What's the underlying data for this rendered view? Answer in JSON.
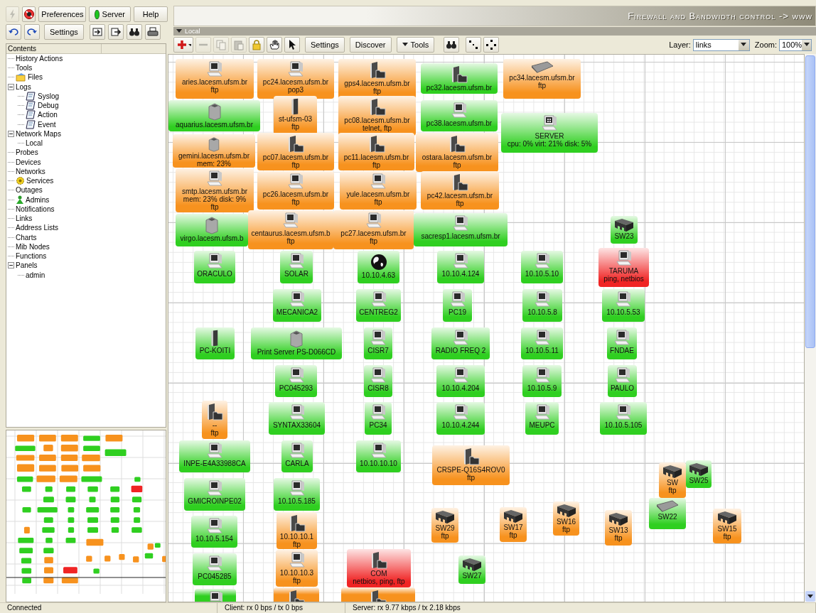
{
  "main_toolbar": {
    "icon_buttons": [
      {
        "kind": "lightning",
        "disabled": true
      },
      {
        "kind": "stop",
        "disabled": false
      }
    ],
    "buttons": [
      {
        "label": "Preferences"
      },
      {
        "label": "Server",
        "online": true
      },
      {
        "label": "Help"
      }
    ]
  },
  "edit_toolbar": {
    "icon_buttons_left": [
      {
        "kind": "undo"
      },
      {
        "kind": "redo"
      }
    ],
    "settings": "Settings",
    "icon_buttons_right": [
      {
        "kind": "import"
      },
      {
        "kind": "export"
      },
      {
        "kind": "find"
      },
      {
        "kind": "print"
      }
    ]
  },
  "banner": "Firewall and Bandwidth control -> www",
  "tree": {
    "header": "Contents",
    "items": [
      {
        "label": "History Actions"
      },
      {
        "label": "Tools"
      },
      {
        "label": "Files",
        "kind": "folder"
      },
      {
        "label": "Logs",
        "expanded": true,
        "children": [
          {
            "label": "Syslog",
            "kind": "log"
          },
          {
            "label": "Debug",
            "kind": "log"
          },
          {
            "label": "Action",
            "kind": "log"
          },
          {
            "label": "Event",
            "kind": "log"
          }
        ]
      },
      {
        "label": "Network Maps",
        "expanded": true,
        "children": [
          {
            "label": "Local"
          }
        ]
      },
      {
        "label": "Probes"
      },
      {
        "label": "Devices"
      },
      {
        "label": "Networks"
      },
      {
        "label": "Services",
        "kind": "services"
      },
      {
        "label": "Outages"
      },
      {
        "label": "Admins",
        "kind": "admins"
      },
      {
        "label": "Notifications"
      },
      {
        "label": "Links"
      },
      {
        "label": "Address Lists"
      },
      {
        "label": "Charts"
      },
      {
        "label": "Mib Nodes"
      },
      {
        "label": "Functions"
      },
      {
        "label": "Panels",
        "expanded": true,
        "children": [
          {
            "label": "admin"
          }
        ]
      }
    ]
  },
  "map_panel": {
    "title": "Local",
    "tools": [
      {
        "kind": "add",
        "disabled": false
      },
      {
        "kind": "remove",
        "disabled": true
      },
      {
        "kind": "copy",
        "disabled": true
      },
      {
        "kind": "paste",
        "disabled": true
      },
      {
        "kind": "lock",
        "disabled": false
      },
      {
        "kind": "hand",
        "disabled": false
      },
      {
        "kind": "pointer",
        "disabled": false
      }
    ],
    "buttons": [
      {
        "label": "Settings"
      },
      {
        "label": "Discover"
      },
      {
        "label": "Tools",
        "kind": "menu"
      }
    ],
    "tools_right": [
      {
        "kind": "find"
      },
      {
        "kind": "arrange"
      },
      {
        "kind": "circle"
      }
    ],
    "layer_label": "Layer:",
    "layer_value": "links",
    "zoom_label": "Zoom:",
    "zoom_value": "100%",
    "nodes": [
      {
        "lines": [
          "aries.lacesm.ufsm.br",
          "ftp"
        ],
        "color": "#f7921e",
        "kind": "pc"
      },
      {
        "lines": [
          "pc24.lacesm.ufsm.br",
          "pop3"
        ],
        "color": "#f7921e",
        "kind": "pc"
      },
      {
        "lines": [
          "gps4.lacesm.ufsm.br",
          "ftp"
        ],
        "color": "#f7921e",
        "kind": "server"
      },
      {
        "lines": [
          "pc32.lacesm.ufsm.br"
        ],
        "color": "#2fcf20",
        "kind": "server"
      },
      {
        "lines": [
          "pc34.lacesm.ufsm.br",
          "ftp"
        ],
        "color": "#f7921e",
        "kind": "router"
      },
      {
        "lines": [
          "aquarius.lacesm.ufsm.br"
        ],
        "color": "#2fcf20",
        "kind": "printer"
      },
      {
        "lines": [
          "st-ufsm-03",
          "ftp"
        ],
        "color": "#f7921e",
        "kind": "tower"
      },
      {
        "lines": [
          "pc08.lacesm.ufsm.br",
          "telnet, ftp"
        ],
        "color": "#f7921e",
        "kind": "server"
      },
      {
        "lines": [
          "pc38.lacesm.ufsm.br"
        ],
        "color": "#2fcf20",
        "kind": "pc"
      },
      {
        "lines": [
          "SERVER",
          "cpu: 0% virt: 21% disk: 5%"
        ],
        "color": "#2fcf20",
        "kind": "windows"
      },
      {
        "lines": [
          "gemini.lacesm.ufsm.br",
          "mem: 23%"
        ],
        "color": "#f7921e",
        "kind": "printer"
      },
      {
        "lines": [
          "pc07.lacesm.ufsm.br",
          "ftp"
        ],
        "color": "#f7921e",
        "kind": "server"
      },
      {
        "lines": [
          "pc11.lacesm.ufsm.br",
          "ftp"
        ],
        "color": "#f7921e",
        "kind": "server"
      },
      {
        "lines": [
          "ostara.lacesm.ufsm.br",
          "ftp"
        ],
        "color": "#f7921e",
        "kind": "server"
      },
      {
        "lines": [
          "smtp.lacesm.ufsm.br",
          "mem: 23% disk: 9%",
          "ftp"
        ],
        "color": "#f7921e",
        "kind": "pc"
      },
      {
        "lines": [
          "pc26.lacesm.ufsm.br",
          "ftp"
        ],
        "color": "#f7921e",
        "kind": "pc"
      },
      {
        "lines": [
          "yule.lacesm.ufsm.br",
          "ftp"
        ],
        "color": "#f7921e",
        "kind": "pc"
      },
      {
        "lines": [
          "pc42.lacesm.ufsm.br",
          "ftp"
        ],
        "color": "#f7921e",
        "kind": "server"
      },
      {
        "lines": [
          "virgo.lacesm.ufsm.b"
        ],
        "color": "#2fcf20",
        "kind": "printer"
      },
      {
        "lines": [
          "centaurus.lacesm.ufsm.b",
          "ftp"
        ],
        "color": "#f7921e",
        "kind": "pc"
      },
      {
        "lines": [
          "pc27.lacesm.ufsm.br",
          "ftp"
        ],
        "color": "#f7921e",
        "kind": "pc"
      },
      {
        "lines": [
          "sacresp1.lacesm.ufsm.br"
        ],
        "color": "#2fcf20",
        "kind": "pc"
      },
      {
        "lines": [
          "SW23"
        ],
        "color": "#2fcf20",
        "kind": "switch"
      },
      {
        "lines": [
          "ORACULO"
        ],
        "color": "#2fcf20",
        "kind": "pc"
      },
      {
        "lines": [
          "SOLAR"
        ],
        "color": "#2fcf20",
        "kind": "pc"
      },
      {
        "lines": [
          "10.10.4.63"
        ],
        "color": "#2fcf20",
        "kind": "globe"
      },
      {
        "lines": [
          "10.10.4.124"
        ],
        "color": "#2fcf20",
        "kind": "pc"
      },
      {
        "lines": [
          "10.10.5.10"
        ],
        "color": "#2fcf20",
        "kind": "pc"
      },
      {
        "lines": [
          "TARUMA",
          "ping, netbios"
        ],
        "color": "#f02424",
        "kind": "pc"
      },
      {
        "lines": [
          "MECANICA2"
        ],
        "color": "#2fcf20",
        "kind": "pc"
      },
      {
        "lines": [
          "CENTREG2"
        ],
        "color": "#2fcf20",
        "kind": "pc"
      },
      {
        "lines": [
          "PC19"
        ],
        "color": "#2fcf20",
        "kind": "pc"
      },
      {
        "lines": [
          "10.10.5.8"
        ],
        "color": "#2fcf20",
        "kind": "pc"
      },
      {
        "lines": [
          "10.10.5.53"
        ],
        "color": "#2fcf20",
        "kind": "pc"
      },
      {
        "lines": [
          "PC-KOITI"
        ],
        "color": "#2fcf20",
        "kind": "tower"
      },
      {
        "lines": [
          "Print Server PS-D066CD"
        ],
        "color": "#2fcf20",
        "kind": "printer"
      },
      {
        "lines": [
          "CISR7"
        ],
        "color": "#2fcf20",
        "kind": "pc"
      },
      {
        "lines": [
          "RADIO FREQ 2"
        ],
        "color": "#2fcf20",
        "kind": "pc"
      },
      {
        "lines": [
          "10.10.5.11"
        ],
        "color": "#2fcf20",
        "kind": "pc"
      },
      {
        "lines": [
          "FNDAE"
        ],
        "color": "#2fcf20",
        "kind": "pc"
      },
      {
        "lines": [
          "PC045293"
        ],
        "color": "#2fcf20",
        "kind": "pc"
      },
      {
        "lines": [
          "CISR8"
        ],
        "color": "#2fcf20",
        "kind": "pc"
      },
      {
        "lines": [
          "10.10.4.204"
        ],
        "color": "#2fcf20",
        "kind": "pc"
      },
      {
        "lines": [
          "10.10.5.9"
        ],
        "color": "#2fcf20",
        "kind": "pc"
      },
      {
        "lines": [
          "PAULO"
        ],
        "color": "#2fcf20",
        "kind": "pc"
      },
      {
        "lines": [
          "--",
          "ftp"
        ],
        "color": "#f7921e",
        "kind": "server"
      },
      {
        "lines": [
          "SYNTAX33604"
        ],
        "color": "#2fcf20",
        "kind": "pc"
      },
      {
        "lines": [
          "PC34"
        ],
        "color": "#2fcf20",
        "kind": "pc"
      },
      {
        "lines": [
          "10.10.4.244"
        ],
        "color": "#2fcf20",
        "kind": "pc"
      },
      {
        "lines": [
          "MEUPC"
        ],
        "color": "#2fcf20",
        "kind": "pc"
      },
      {
        "lines": [
          "10.10.5.105"
        ],
        "color": "#2fcf20",
        "kind": "pc"
      },
      {
        "lines": [
          "INPE-E4A33988CA"
        ],
        "color": "#2fcf20",
        "kind": "pc"
      },
      {
        "lines": [
          "CARLA"
        ],
        "color": "#2fcf20",
        "kind": "pc"
      },
      {
        "lines": [
          "10.10.10.10"
        ],
        "color": "#2fcf20",
        "kind": "pc"
      },
      {
        "lines": [
          "CRSPE-Q16S4ROV0",
          "ftp"
        ],
        "color": "#f7921e",
        "kind": "server"
      },
      {
        "lines": [
          "SW",
          "ftp"
        ],
        "color": "#f7921e",
        "kind": "switch"
      },
      {
        "lines": [
          "SW25"
        ],
        "color": "#2fcf20",
        "kind": "switch"
      },
      {
        "lines": [
          "GMICROINPE02"
        ],
        "color": "#2fcf20",
        "kind": "pc"
      },
      {
        "lines": [
          "10.10.5.185"
        ],
        "color": "#2fcf20",
        "kind": "pc"
      },
      {
        "lines": [
          "10.10.5.154"
        ],
        "color": "#2fcf20",
        "kind": "pc"
      },
      {
        "lines": [
          "10.10.10.1",
          "ftp"
        ],
        "color": "#f7921e",
        "kind": "server"
      },
      {
        "lines": [
          "SW29",
          "ftp"
        ],
        "color": "#f7921e",
        "kind": "switch"
      },
      {
        "lines": [
          "SW17",
          "ftp"
        ],
        "color": "#f7921e",
        "kind": "switch"
      },
      {
        "lines": [
          "SW16",
          "ftp"
        ],
        "color": "#f7921e",
        "kind": "switch"
      },
      {
        "lines": [
          "SW22"
        ],
        "color": "#2fcf20",
        "kind": "router"
      },
      {
        "lines": [
          "SW13",
          "ftp"
        ],
        "color": "#f7921e",
        "kind": "switch"
      },
      {
        "lines": [
          "SW15",
          "ftp"
        ],
        "color": "#f7921e",
        "kind": "switch"
      },
      {
        "lines": [
          "PC045285"
        ],
        "color": "#2fcf20",
        "kind": "pc"
      },
      {
        "lines": [
          "10.10.10.3",
          "ftp"
        ],
        "color": "#f7921e",
        "kind": "pc"
      },
      {
        "lines": [
          "COM",
          "netbios, ping, ftp"
        ],
        "color": "#f02424",
        "kind": "server"
      },
      {
        "lines": [
          "SW27"
        ],
        "color": "#2fcf20",
        "kind": "switch"
      },
      {
        "color": "#2fcf20",
        "kind": "pc"
      },
      {
        "color": "#f7921e",
        "kind": "server"
      },
      {
        "color": "#f7921e",
        "kind": "server"
      }
    ]
  },
  "status_bar": [
    "Connected",
    "Client: rx 0 bps / tx 0 bps",
    "Server: rx 9.77 kbps / tx 2.18 kbps"
  ]
}
